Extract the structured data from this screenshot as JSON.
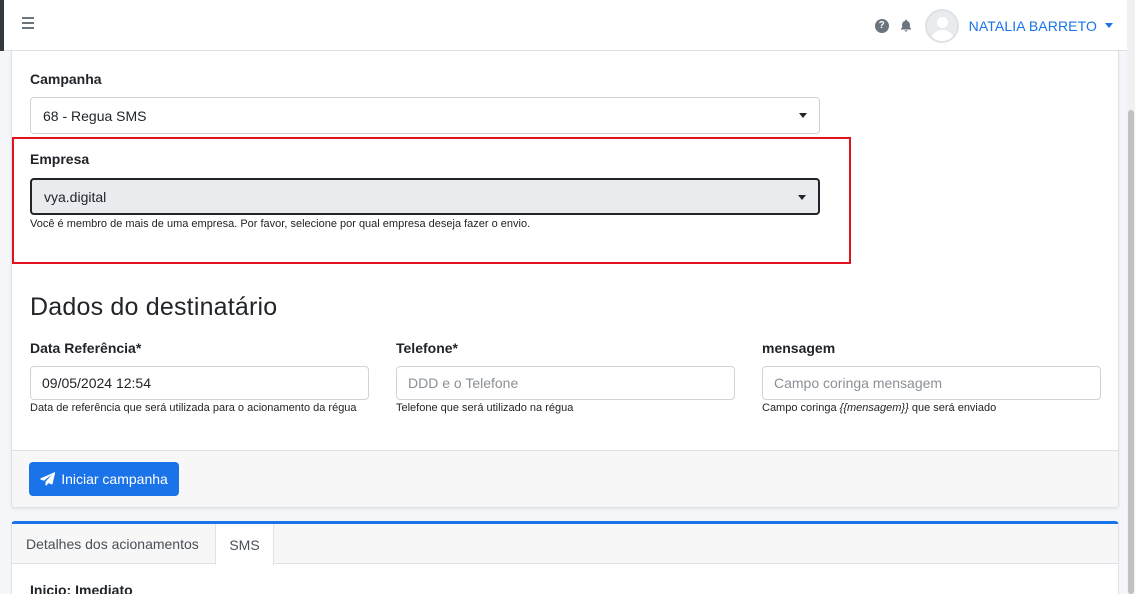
{
  "header": {
    "user_name": "NATALIA BARRETO",
    "icons": [
      "menu-icon",
      "help-icon",
      "bell-icon",
      "avatar",
      "chevron-down-icon"
    ]
  },
  "form": {
    "campanha": {
      "label": "Campanha",
      "value": "68 - Regua SMS"
    },
    "empresa": {
      "label": "Empresa",
      "value": "vya.digital",
      "help": "Você é membro de mais de uma empresa. Por favor, selecione por qual empresa deseja fazer o envio."
    },
    "section_title": "Dados do destinatário",
    "data_referencia": {
      "label": "Data Referência*",
      "value": "09/05/2024 12:54",
      "help": "Data de referência que será utilizada para o acionamento da régua"
    },
    "telefone": {
      "label": "Telefone*",
      "placeholder": "DDD e o Telefone",
      "help": "Telefone que será utilizado na régua"
    },
    "mensagem": {
      "label": "mensagem",
      "placeholder": "Campo coringa mensagem",
      "help_prefix": "Campo coringa ",
      "help_code": "{{mensagem}}",
      "help_suffix": " que será enviado"
    },
    "submit_label": "Iniciar campanha"
  },
  "details": {
    "tabs": [
      "Detalhes dos acionamentos",
      "SMS"
    ],
    "active_tab": "SMS",
    "inicio": "Inicio: Imediato"
  },
  "colors": {
    "primary": "#1a73e8",
    "highlight": "#e0121b"
  }
}
